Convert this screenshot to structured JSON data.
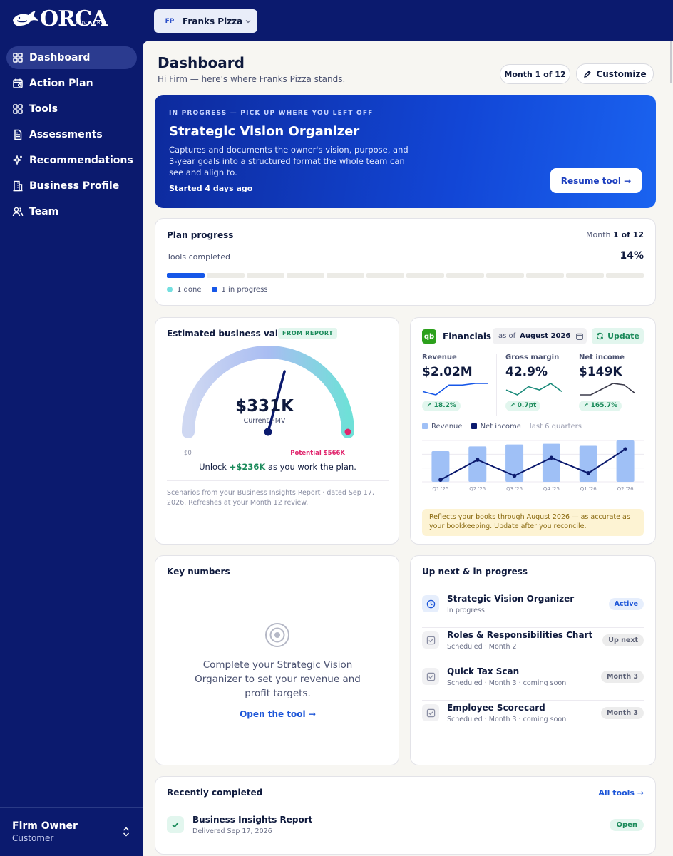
{
  "brand": {
    "name": "ORCA",
    "sub": "ADVISOR"
  },
  "business_selector": {
    "initials": "FP",
    "name": "Franks Pizza"
  },
  "sidebar": {
    "items": [
      {
        "label": "Dashboard",
        "icon": "grid-icon",
        "active": true
      },
      {
        "label": "Action Plan",
        "icon": "calendar-icon"
      },
      {
        "label": "Tools",
        "icon": "tools-grid-icon"
      },
      {
        "label": "Assessments",
        "icon": "document-icon"
      },
      {
        "label": "Recommendations",
        "icon": "sparkle-icon"
      },
      {
        "label": "Business Profile",
        "icon": "building-icon"
      },
      {
        "label": "Team",
        "icon": "team-icon"
      }
    ],
    "user": {
      "name": "Firm Owner",
      "role": "Customer"
    }
  },
  "header": {
    "title": "Dashboard",
    "subtitle": "Hi Firm — here's where Franks Pizza stands.",
    "month_button": "Month 1 of 12",
    "customize_button": "Customize"
  },
  "hero": {
    "eyebrow": "IN PROGRESS — PICK UP WHERE YOU LEFT OFF",
    "title": "Strategic Vision Organizer",
    "description": "Captures and documents the owner's vision, purpose, and 3-year goals into a structured format the whole team can see and align to.",
    "started": "Started 4 days ago",
    "button": "Resume tool →"
  },
  "plan": {
    "title": "Plan progress",
    "month_prefix": "Month",
    "month_value": "1 of 12",
    "tools_label": "Tools completed",
    "percent": "14%",
    "segments_total": 12,
    "segments_done": 1,
    "legend_done": "1 done",
    "legend_in_progress": "1 in progress",
    "color_done": "#74dfe0",
    "color_in_progress": "#1657e8"
  },
  "value_card": {
    "title": "Estimated business value",
    "badge": "FROM REPORT",
    "value": "$331K",
    "value_label": "Current FMV",
    "min_label": "$0",
    "potential_label": "Potential $566K",
    "current": 331,
    "max": 566,
    "unlock_prefix": "Unlock",
    "unlock_amount": "+$236K",
    "unlock_suffix": "as you work the plan.",
    "note": "Scenarios from your Business Insights Report · dated Sep 17, 2026. Refreshes at your Month 12 review."
  },
  "financials": {
    "title": "Financials",
    "logo": "qb",
    "as_of_label": "as of",
    "as_of_value": "August 2026",
    "update_button": "Update",
    "kpis": [
      {
        "label": "Revenue",
        "value": "$2.02M",
        "change": "↗ 18.2%",
        "spark": [
          4,
          2,
          8,
          8,
          9,
          9
        ],
        "color": "#1657e8"
      },
      {
        "label": "Gross margin",
        "value": "42.9%",
        "change": "↗ 0.7pt",
        "spark": [
          6,
          3,
          8,
          6,
          10,
          5
        ],
        "color": "#1a8a7a"
      },
      {
        "label": "Net income",
        "value": "$149K",
        "change": "↗ 165.7%",
        "spark": [
          2,
          2,
          6,
          10,
          9,
          3
        ],
        "color": "#3a3a4a"
      }
    ],
    "legend_revenue": "Revenue",
    "legend_net_income": "Net income",
    "legend_range": "last 6 quarters",
    "chart_data": {
      "type": "bar",
      "categories": [
        "Q1 '25",
        "Q2 '25",
        "Q3 '25",
        "Q4 '25",
        "Q1 '26",
        "Q2 '26"
      ],
      "series": [
        {
          "name": "Revenue",
          "type": "bar",
          "values": [
            46,
            53,
            56,
            57,
            54,
            62
          ],
          "color": "#9fc0f6"
        },
        {
          "name": "Net income",
          "type": "line",
          "values": [
            3,
            33,
            9,
            36,
            13,
            49
          ],
          "color": "#0b1a6e"
        }
      ],
      "ylim": [
        0,
        62
      ]
    },
    "note": "Reflects your books through August 2026 — as accurate as your bookkeeping. Update after you reconcile."
  },
  "key_numbers": {
    "title": "Key numbers",
    "message": "Complete your Strategic Vision Organizer to set your revenue and profit targets.",
    "link": "Open the tool →"
  },
  "up_next": {
    "title": "Up next & in progress",
    "tasks": [
      {
        "title": "Strategic Vision Organizer",
        "sub": "In progress",
        "badge": "Active",
        "active": true
      },
      {
        "title": "Roles & Responsibilities Chart",
        "sub": "Scheduled · Month 2",
        "badge": "Up next"
      },
      {
        "title": "Quick Tax Scan",
        "sub": "Scheduled · Month 3 · coming soon",
        "badge": "Month 3"
      },
      {
        "title": "Employee Scorecard",
        "sub": "Scheduled · Month 3 · coming soon",
        "badge": "Month 3"
      }
    ]
  },
  "recent": {
    "title": "Recently completed",
    "link": "All tools →",
    "item_title": "Business Insights Report",
    "item_sub": "Delivered Sep 17, 2026",
    "item_button": "Open"
  }
}
